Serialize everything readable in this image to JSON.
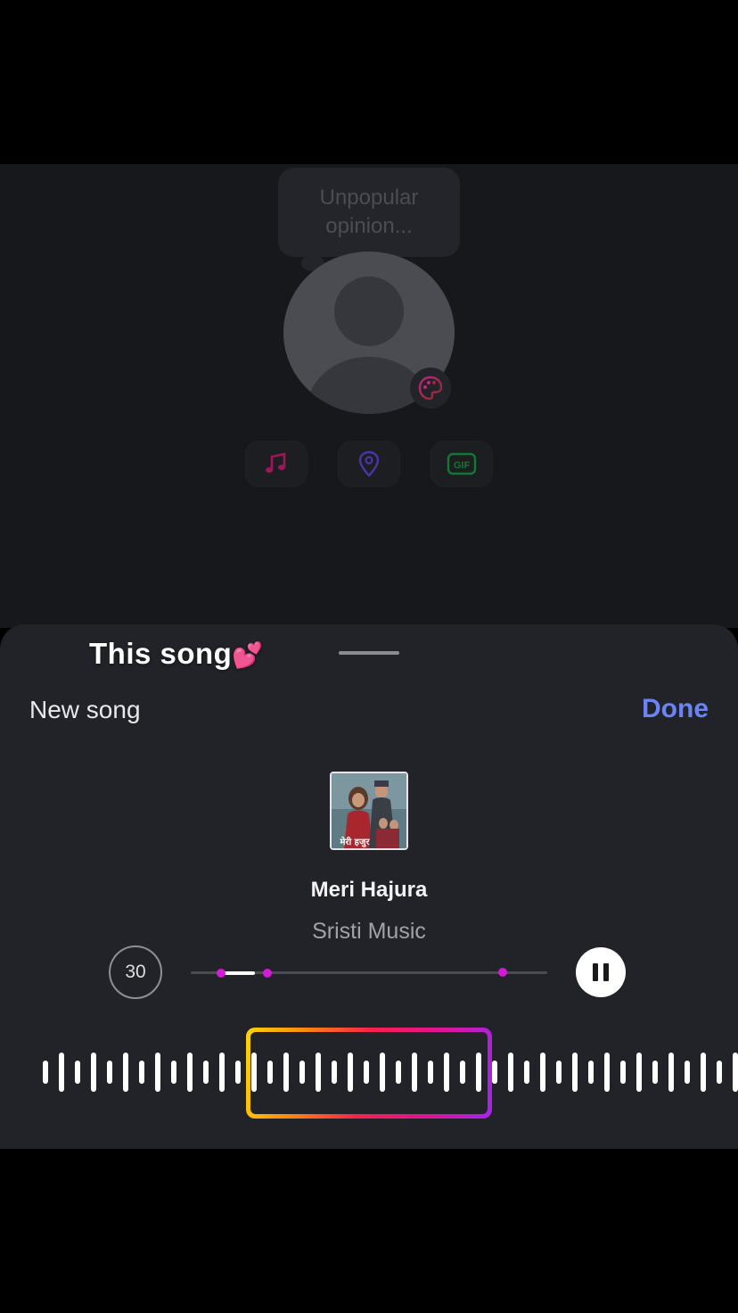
{
  "background": {
    "note_placeholder": "Unpopular opinion...",
    "chips": [
      {
        "name": "music-chip",
        "icon": "music-note-icon",
        "color": "#c2185b"
      },
      {
        "name": "location-chip",
        "icon": "location-pin-icon",
        "color": "#6a3fd1"
      },
      {
        "name": "gif-chip",
        "icon": "gif-icon",
        "color": "#13a34a",
        "label": "GIF"
      }
    ]
  },
  "sheet": {
    "caption": "This song",
    "caption_emoji": "💕",
    "new_song_label": "New song",
    "done_label": "Done",
    "song": {
      "title": "Meri Hajura",
      "artist": "Sristi Music",
      "album_art_text": "मेरी हजुर"
    },
    "duration_label": "30",
    "playback_state": "playing",
    "colors": {
      "accent_done": "#6b84f5",
      "marker": "#d31bd6",
      "selection_gradient": [
        "#fdd30a",
        "#fb8a0e",
        "#f7214d",
        "#e3138c",
        "#a523ee"
      ]
    }
  }
}
